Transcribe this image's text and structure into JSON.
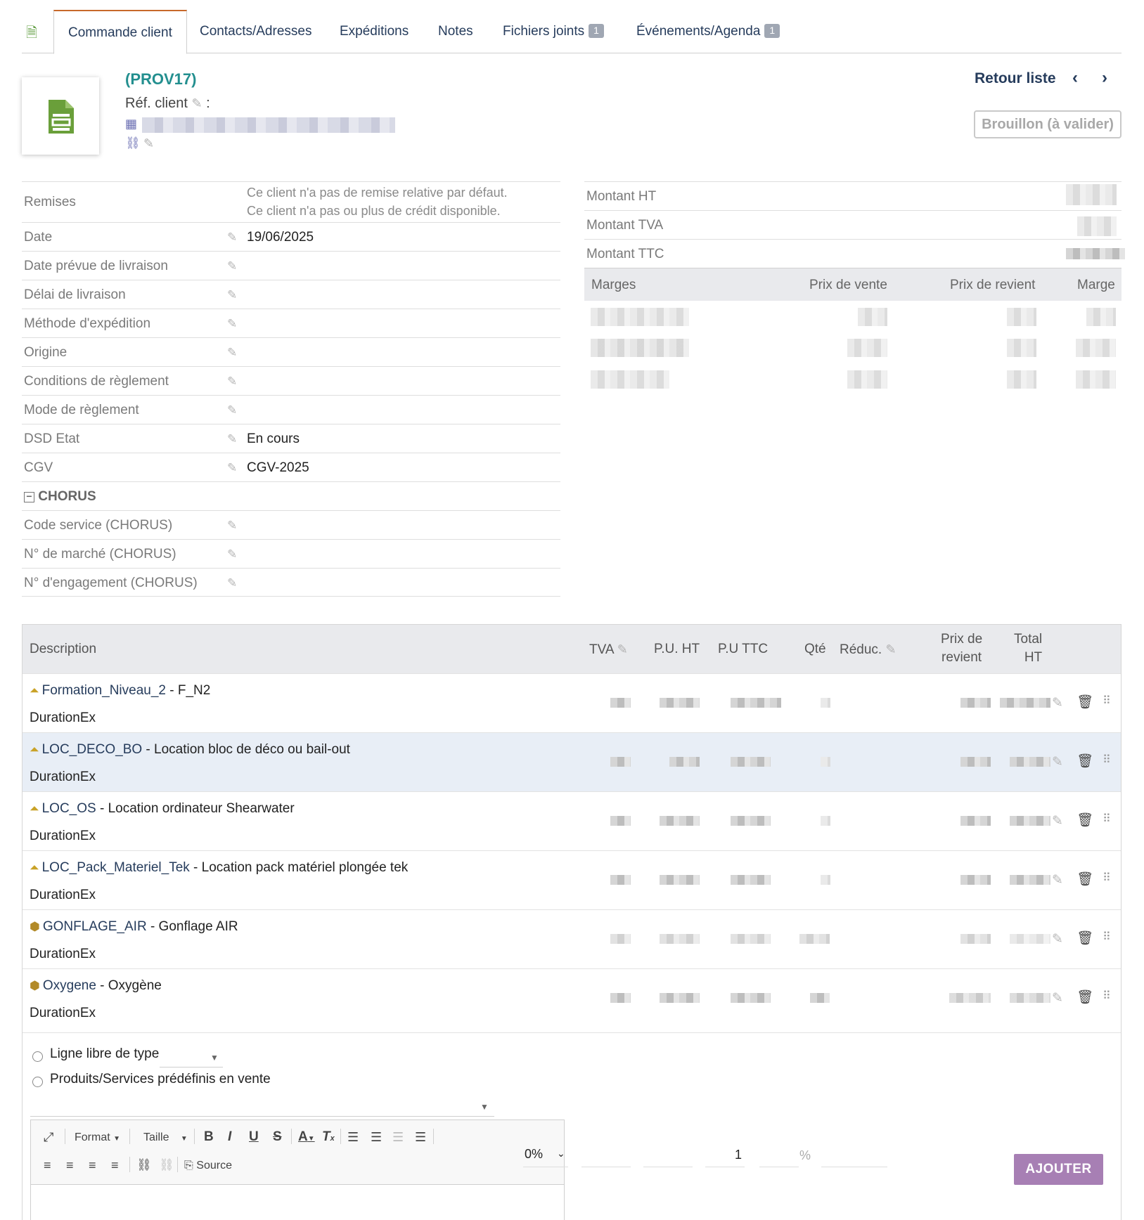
{
  "tabs": [
    {
      "label": "Commande client"
    },
    {
      "label": "Contacts/Adresses"
    },
    {
      "label": "Expéditions"
    },
    {
      "label": "Notes"
    },
    {
      "label": "Fichiers joints",
      "badge": "1"
    },
    {
      "label": "Événements/Agenda",
      "badge": "1"
    }
  ],
  "header": {
    "ref": "(PROV17)",
    "ref_client_label": "Réf. client",
    "ref_client_sep": ":",
    "back_link": "Retour liste",
    "status": "Brouillon (à valider)"
  },
  "fields": {
    "remises_label": "Remises",
    "remises_line1": "Ce client n'a pas de remise relative par défaut.",
    "remises_line2": "Ce client n'a pas ou plus de crédit disponible.",
    "date_label": "Date",
    "date_value": "19/06/2025",
    "date_livraison_label": "Date prévue de livraison",
    "delai_label": "Délai de livraison",
    "methode_label": "Méthode d'expédition",
    "origine_label": "Origine",
    "conditions_label": "Conditions de règlement",
    "mode_label": "Mode de règlement",
    "dsd_label": "DSD Etat",
    "dsd_value": "En cours",
    "cgv_label": "CGV",
    "cgv_value": "CGV-2025",
    "chorus_label": "CHORUS",
    "code_service_label": "Code service (CHORUS)",
    "marche_label": "N° de marché (CHORUS)",
    "engagement_label": "N° d'engagement (CHORUS)"
  },
  "amounts": {
    "ht_label": "Montant HT",
    "tva_label": "Montant TVA",
    "ttc_label": "Montant TTC"
  },
  "margins": {
    "col_marges": "Marges",
    "col_prix_vente": "Prix de vente",
    "col_prix_revient": "Prix de revient",
    "col_marge": "Marge"
  },
  "lines_header": {
    "description": "Description",
    "tva": "TVA",
    "pu_ht": "P.U. HT",
    "pu_ttc": "P.U TTC",
    "qte": "Qté",
    "reduc": "Réduc.",
    "prix_revient_1": "Prix de",
    "prix_revient_2": "revient",
    "total_ht_1": "Total",
    "total_ht_2": "HT"
  },
  "lines": [
    {
      "code": "Formation_Niveau_2",
      "label": " - F_N2",
      "sub": "DurationEx",
      "icon": "service-icon"
    },
    {
      "code": "LOC_DECO_BO",
      "label": " - Location bloc de déco ou bail-out",
      "sub": "DurationEx",
      "icon": "service-icon"
    },
    {
      "code": "LOC_OS",
      "label": " - Location ordinateur Shearwater",
      "sub": "DurationEx",
      "icon": "service-icon"
    },
    {
      "code": "LOC_Pack_Materiel_Tek",
      "label": " - Location pack matériel plongée tek",
      "sub": "DurationEx",
      "icon": "service-icon"
    },
    {
      "code": "GONFLAGE_AIR",
      "label": " - Gonflage AIR",
      "sub": "DurationEx",
      "icon": "product-icon"
    },
    {
      "code": "Oxygene",
      "label": " - Oxygène",
      "sub": "DurationEx",
      "icon": "product-icon"
    }
  ],
  "addline": {
    "free_line_label": "Ligne libre de type",
    "predefined_label": "Produits/Services prédéfinis en vente",
    "format_label": "Format",
    "taille_label": "Taille",
    "source_label": "Source",
    "tva_value": "0%",
    "qty_value": "1",
    "percent": "%",
    "add_button": "AJOUTER"
  }
}
